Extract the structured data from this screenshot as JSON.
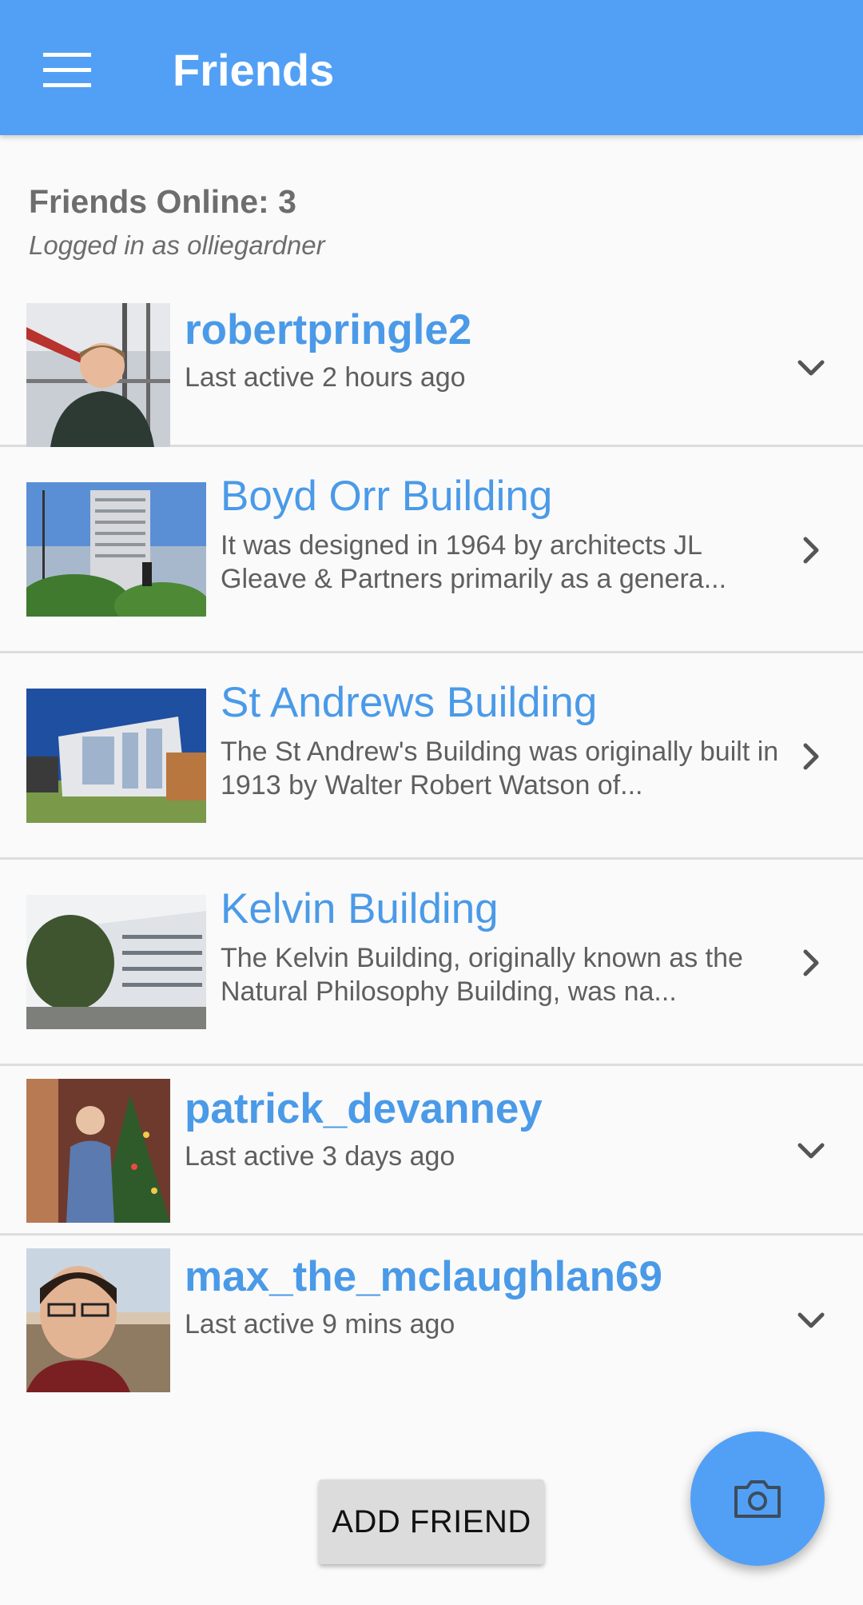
{
  "appbar": {
    "title": "Friends",
    "menu_icon": "hamburger-menu-icon"
  },
  "status": {
    "online_text": "Friends Online: 3",
    "logged_in_text": "Logged in as olliegardner"
  },
  "rows": [
    {
      "kind": "user",
      "title": "robertpringle2",
      "subtitle": "Last active 2 hours ago",
      "action_icon": "chevron-down-icon"
    },
    {
      "kind": "place",
      "title": "Boyd Orr Building",
      "subtitle": "It was designed in 1964 by architects JL Gleave & Partners primarily as a genera...",
      "action_icon": "chevron-right-icon"
    },
    {
      "kind": "place",
      "title": "St Andrews Building",
      "subtitle": "The St Andrew's Building was originally built in 1913 by Walter Robert Watson of...",
      "action_icon": "chevron-right-icon"
    },
    {
      "kind": "place",
      "title": "Kelvin Building",
      "subtitle": "The Kelvin Building, originally known as the Natural Philosophy Building, was na...",
      "action_icon": "chevron-right-icon"
    },
    {
      "kind": "user",
      "title": "patrick_devanney",
      "subtitle": "Last active 3 days ago",
      "action_icon": "chevron-down-icon"
    },
    {
      "kind": "user",
      "title": "max_the_mclaughlan69",
      "subtitle": "Last active 9 mins ago",
      "action_icon": "chevron-down-icon"
    }
  ],
  "buttons": {
    "add_friend": "ADD FRIEND",
    "fab_icon": "camera-icon"
  },
  "colors": {
    "primary": "#52a0f5",
    "link_text": "#4a9ae8",
    "background": "#fafafa"
  }
}
